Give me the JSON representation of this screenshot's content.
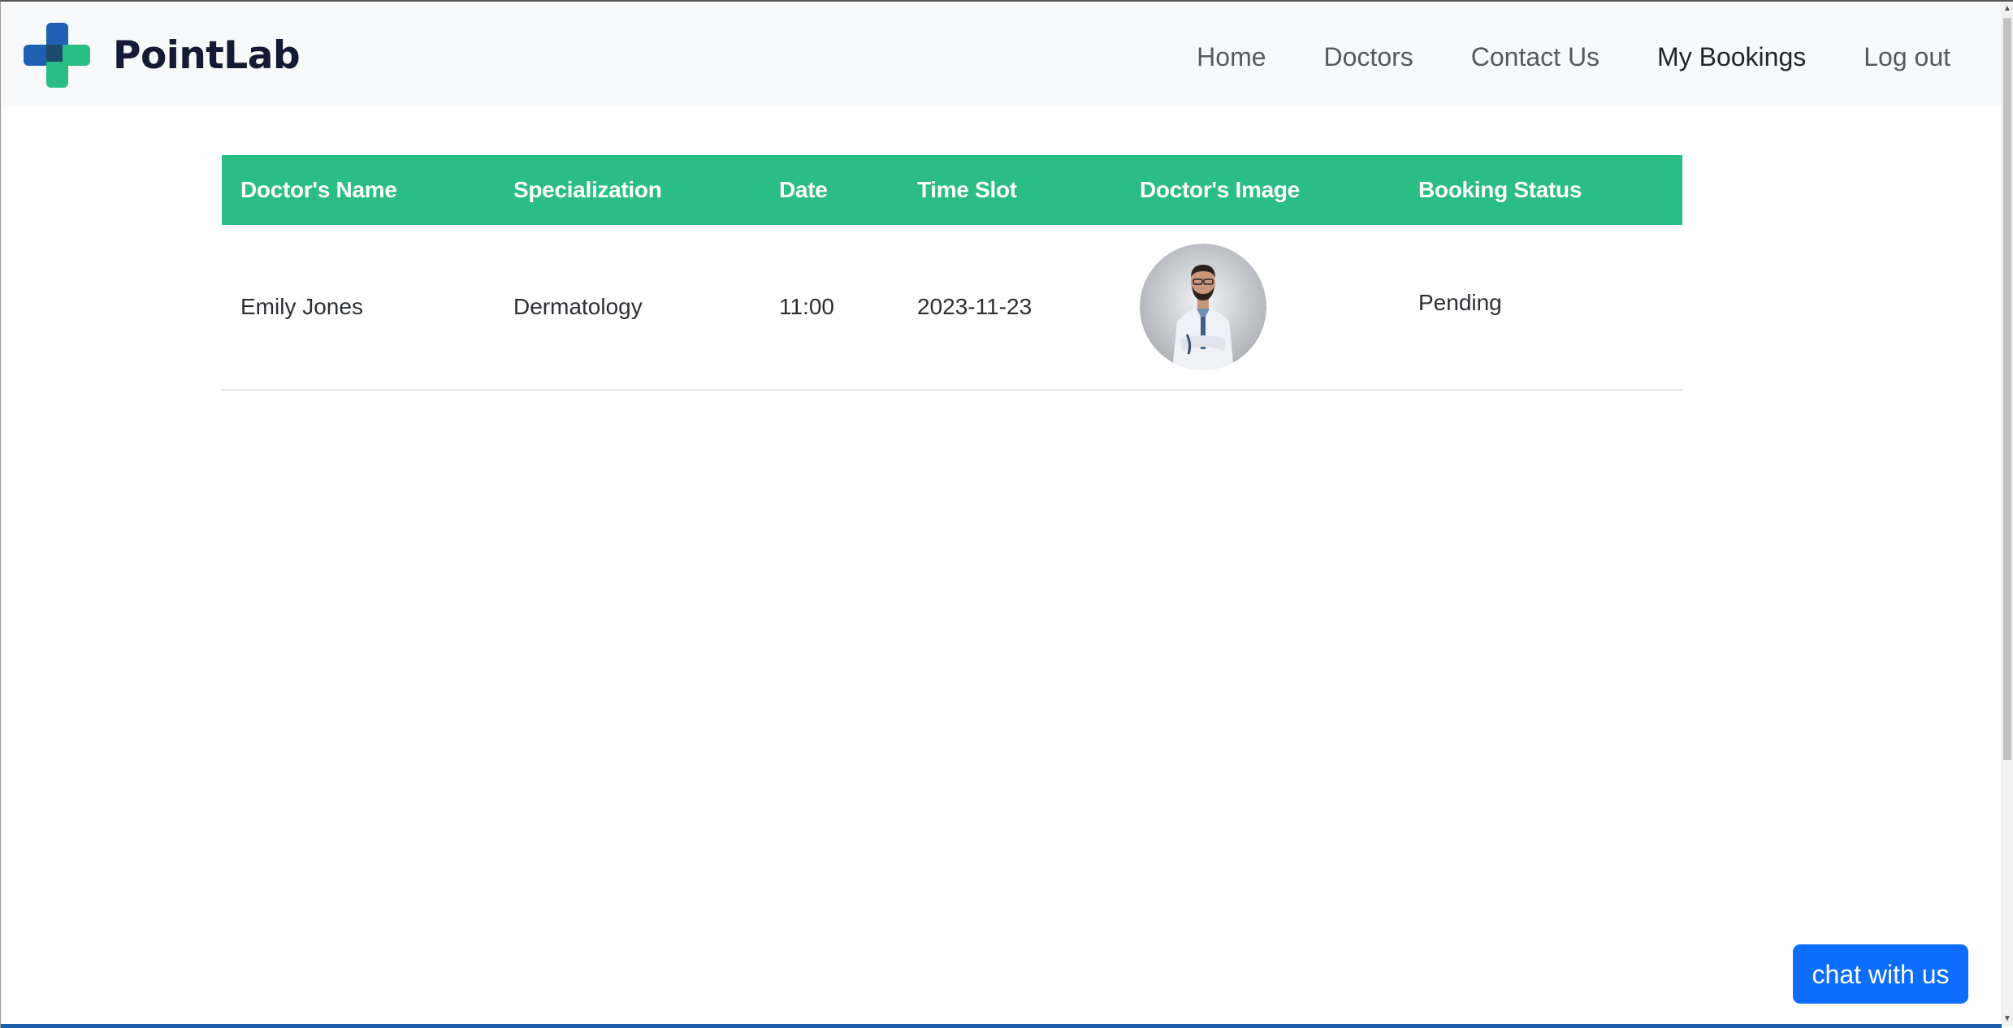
{
  "brand": {
    "name": "PointLab",
    "logo_icon": "medical-cross-icon",
    "colors": {
      "blue": "#1f5fb4",
      "green": "#2abd84",
      "overlap": "#1d4a6d"
    }
  },
  "nav": {
    "items": [
      {
        "label": "Home",
        "active": false
      },
      {
        "label": "Doctors",
        "active": false
      },
      {
        "label": "Contact Us",
        "active": false
      },
      {
        "label": "My Bookings",
        "active": true
      },
      {
        "label": "Log out",
        "active": false
      }
    ]
  },
  "table": {
    "header_color": "#2abd84",
    "headers": [
      "Doctor's Name",
      "Specialization",
      "Date",
      "Time Slot",
      "Doctor's Image",
      "Booking Status"
    ],
    "rows": [
      {
        "doctor_name": "Emily Jones",
        "specialization": "Dermatology",
        "date": "11:00",
        "time_slot": "2023-11-23",
        "image": "doctor-avatar",
        "status": "Pending"
      }
    ]
  },
  "chat": {
    "label": "chat with us",
    "color": "#0d6efd"
  }
}
